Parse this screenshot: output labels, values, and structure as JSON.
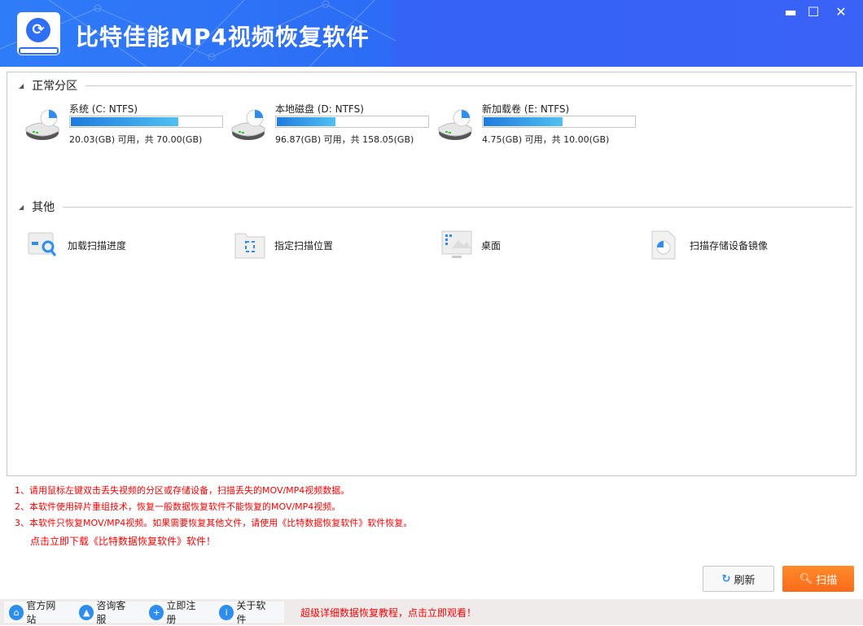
{
  "app": {
    "title": "比特佳能MP4视频恢复软件"
  },
  "window_controls": {
    "minimize": "▬",
    "maximize": "☐",
    "close": "✕"
  },
  "sections": {
    "partitions": "正常分区",
    "other": "其他"
  },
  "drives": [
    {
      "name": "系统 (C: NTFS)",
      "info": "20.03(GB) 可用，共 70.00(GB)",
      "used_fraction": 0.714
    },
    {
      "name": "本地磁盘 (D: NTFS)",
      "info": "96.87(GB) 可用，共 158.05(GB)",
      "used_fraction": 0.387
    },
    {
      "name": "新加载卷 (E: NTFS)",
      "info": "4.75(GB) 可用，共 10.00(GB)",
      "used_fraction": 0.525
    }
  ],
  "others": [
    {
      "label": "加载扫描进度",
      "icon": "load-progress-icon"
    },
    {
      "label": "指定扫描位置",
      "icon": "folder-target-icon"
    },
    {
      "label": "桌面",
      "icon": "desktop-icon"
    },
    {
      "label": "扫描存储设备镜像",
      "icon": "disk-image-icon"
    }
  ],
  "notes": [
    "1、请用鼠标左键双击丢失视频的分区或存储设备，扫描丢失的MOV/MP4视频数据。",
    "2、本软件使用碎片重组技术，恢复一般数据恢复软件不能恢复的MOV/MP4视频。",
    "3、本软件只恢复MOV/MP4视频。如果需要恢复其他文件，请使用《比特数据恢复软件》软件恢复。",
    "点击立即下载《比特数据恢复软件》软件！"
  ],
  "buttons": {
    "refresh": "刷新",
    "scan": "扫描"
  },
  "footer": {
    "tabs": [
      "官方网站",
      "咨询客服",
      "立即注册",
      "关于软件"
    ],
    "link": "超级详细数据恢复教程，点击立即观看！"
  },
  "colors": {
    "brand": "#2f6ff5",
    "accent": "#fb6b1a",
    "note": "#ff0000"
  }
}
